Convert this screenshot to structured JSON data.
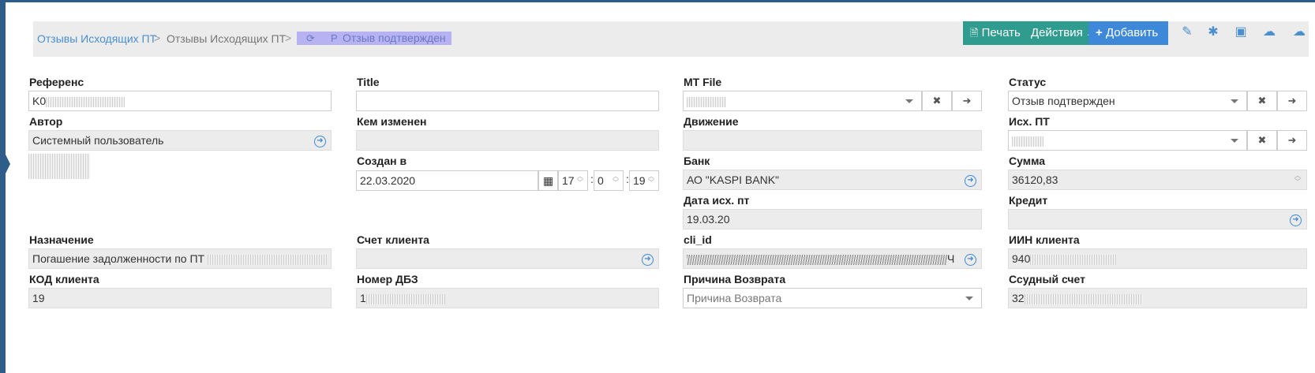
{
  "breadcrumb": {
    "item1": "Отзывы Исходящих ПТ",
    "item2": "Отзывы Исходящих ПТ",
    "separator": ">",
    "active": "Отзыв подтвержден"
  },
  "toolbar": {
    "print": "Печать",
    "actions": "Действия",
    "add": "Добавить",
    "colors": {
      "green": "#2f9c8f",
      "blue": "#3d88d8"
    }
  },
  "form": {
    "reference": {
      "label": "Референс",
      "value": "K0"
    },
    "title": {
      "label": "Title",
      "value": ""
    },
    "mt_file": {
      "label": "MT File",
      "value": ""
    },
    "status": {
      "label": "Статус",
      "value": "Отзыв подтвержден"
    },
    "author": {
      "label": "Автор",
      "value": "Системный пользователь"
    },
    "changed_by": {
      "label": "Кем изменен",
      "value": ""
    },
    "movement": {
      "label": "Движение",
      "value": ""
    },
    "outgoing_pt": {
      "label": "Исх. ПТ",
      "value": ""
    },
    "created_at": {
      "label": "Создан в",
      "date": "22.03.2020",
      "hour": "17",
      "minute": "0",
      "second": "19",
      "sep": ":"
    },
    "bank": {
      "label": "Банк",
      "value": "АО \"KASPI BANK\""
    },
    "amount": {
      "label": "Сумма",
      "value": "36120,83"
    },
    "outgoing_date": {
      "label": "Дата исх. пт",
      "value": "19.03.20"
    },
    "credit": {
      "label": "Кредит",
      "value": ""
    },
    "purpose": {
      "label": "Назначение",
      "value": "Погашение задолженности по ПТ"
    },
    "client_account": {
      "label": "Счет клиента",
      "value": ""
    },
    "cli_id": {
      "label": "cli_id",
      "value": "Ч"
    },
    "client_iin": {
      "label": "ИИН клиента",
      "value": "940"
    },
    "client_code": {
      "label": "КОД клиента",
      "value": "19"
    },
    "dbz_number": {
      "label": "Номер ДБЗ",
      "value": "1"
    },
    "return_reason": {
      "label": "Причина Возврата",
      "placeholder": "Причина Возврата"
    },
    "loan_account": {
      "label": "Ссудный счет",
      "value": "32"
    }
  }
}
